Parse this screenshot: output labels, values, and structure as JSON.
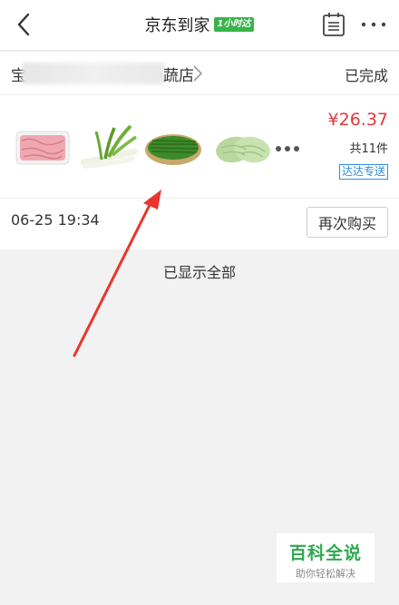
{
  "header": {
    "title": "京东到家",
    "badge": "1小时达"
  },
  "order": {
    "store_prefix": "宝",
    "store_suffix": "蔬店",
    "status": "已完成",
    "price": "¥26.37",
    "item_count": "共11件",
    "delivery": "达达专送",
    "time": "06-25 19:34",
    "rebuy_label": "再次购买",
    "products": [
      {
        "name": "minced-meat",
        "color": "#f0a8b0"
      },
      {
        "name": "scallion",
        "color": "#6fae3a"
      },
      {
        "name": "green-beans",
        "color": "#3d8a2b"
      },
      {
        "name": "bitter-gourd",
        "color": "#b9d8a0"
      }
    ]
  },
  "footer": {
    "all_shown": "已显示全部"
  },
  "watermark": {
    "title": "百科全说",
    "subtitle": "助你轻松解决"
  },
  "colors": {
    "price": "#e4393c",
    "badge": "#38b449",
    "dada": "#2d8de4",
    "arrow": "#e8362e"
  }
}
